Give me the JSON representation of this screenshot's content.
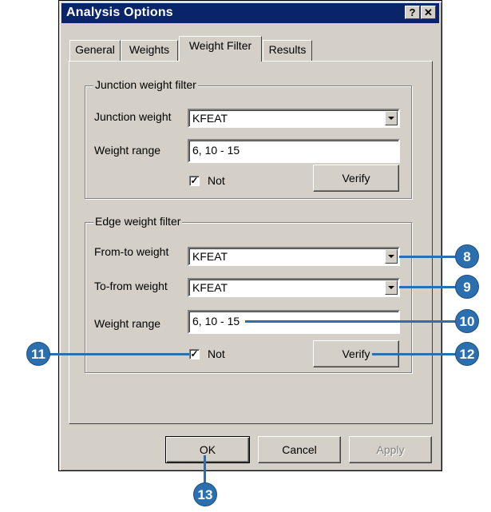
{
  "window": {
    "title": "Analysis Options",
    "help_label": "?",
    "close_label": "✕"
  },
  "tabs": [
    {
      "label": "General"
    },
    {
      "label": "Weights"
    },
    {
      "label": "Weight Filter"
    },
    {
      "label": "Results"
    }
  ],
  "junction": {
    "legend": "Junction weight filter",
    "weight_label": "Junction weight",
    "weight_value": "KFEAT",
    "range_label": "Weight range",
    "range_value": "6, 10 - 15",
    "not_label": "Not",
    "not_checked": true,
    "verify_label": "Verify"
  },
  "edge": {
    "legend": "Edge weight filter",
    "fromto_label": "From-to weight",
    "fromto_value": "KFEAT",
    "tofrom_label": "To-from weight",
    "tofrom_value": "KFEAT",
    "range_label": "Weight range",
    "range_value": "6, 10 - 15",
    "not_label": "Not",
    "not_checked": true,
    "verify_label": "Verify"
  },
  "buttons": {
    "ok": "OK",
    "cancel": "Cancel",
    "apply": "Apply"
  },
  "callouts": {
    "c8": "8",
    "c9": "9",
    "c10": "10",
    "c11": "11",
    "c12": "12",
    "c13": "13"
  },
  "colors": {
    "callout": "#2b6faf",
    "titlebar": "#0a246a",
    "face": "#d4d0c8"
  }
}
